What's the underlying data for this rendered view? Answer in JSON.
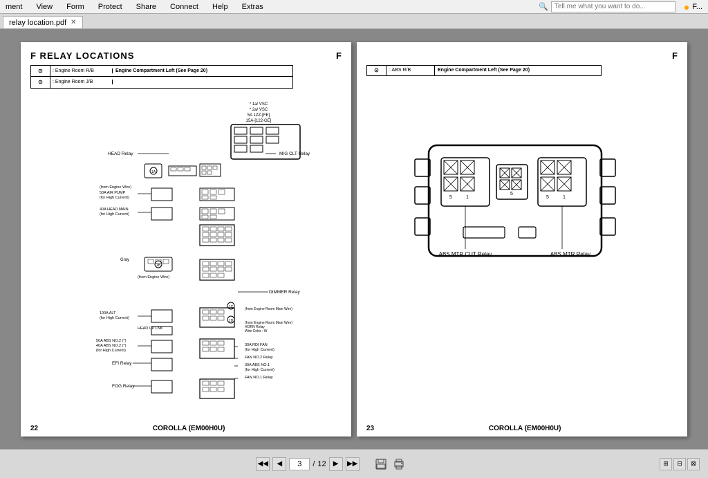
{
  "menubar": {
    "items": [
      "ment",
      "View",
      "Form",
      "Protect",
      "Share",
      "Connect",
      "Help",
      "Extras"
    ],
    "search_placeholder": "Tell me what you want to do...",
    "icons_right": [
      "orange-icon",
      "f-icon"
    ]
  },
  "tab": {
    "label": "relay location.pdf",
    "active": true
  },
  "page_left": {
    "header_title": "F  RELAY LOCATIONS",
    "letter": "",
    "legend": {
      "rows": [
        {
          "symbol": "⊙",
          "label": ": Engine Room R/B",
          "desc": "Engine Compartment Left (See Page 20)"
        },
        {
          "symbol": "⊙",
          "label": ": Engine Room J/B",
          "desc": ""
        }
      ]
    },
    "page_num": "22",
    "model": "COROLLA (EM00H0U)"
  },
  "page_right": {
    "letter": "F",
    "legend": {
      "symbol": "⊙",
      "label": ": ABS R/B",
      "desc": "Engine Compartment Left (See Page 20)"
    },
    "labels": {
      "abs_mtr_cut_relay": "ABS MTR CUT Relay",
      "abs_mtr_relay": "ABS MTR Relay"
    },
    "page_num": "23",
    "model": "COROLLA (EM00H0U)"
  },
  "toolbar": {
    "prev_prev": "◀◀",
    "prev": "◀",
    "page_current": "3",
    "page_separator": "/",
    "page_total": "12",
    "next": "▶",
    "next_next": "▶▶",
    "zoom_in": "🔍",
    "save": "💾",
    "print": "🖨"
  },
  "labels": {
    "head_relay": "HEAD Relay",
    "mfg_clt_relay": "M/G CLT Relay",
    "from_engine_wire": "from Engine Wire)",
    "50a_air_pump": "50A AIR PUMP\n(for High Current)",
    "40a_head_main": "40A HEAD MAIN\n(for High Current)",
    "gray": "Gray",
    "from_engine_wire2": "(from Engine Wire)",
    "dimmer_relay": "DIMMER Relay",
    "100a_alt": "100A ALT\n(for High Current)",
    "head_up_lnk": "HEAD UP LNK",
    "50a_abs_no2": "50A ABS NO.2 (*)\n40A ABS NO.2 (*)\n(for High Current)",
    "efi_relay": "EFI Relay",
    "fog_relay": "FOG Relay",
    "from_engine_room": "(from Engine Room Main Wire)",
    "horn_relay": "HORN Relay",
    "wire_color_w": "Wire Color : W",
    "30a_rdi_fan": "30A RDI FAN\n(for High Current)",
    "fan_no2_relay": "FAN NO.2 Relay",
    "30a_abs_no1": "30A ABS NO.1\n(for High Current)",
    "fan_no1_relay": "FAN NO.1 Relay",
    "1a_vsc": "* 1a/ VSC",
    "2a_vsc": "* 2a/ VSC",
    "5a_1200fe": "5A 1ZZ-(FE)",
    "15a_122ge": "15A-[122-GE]"
  }
}
